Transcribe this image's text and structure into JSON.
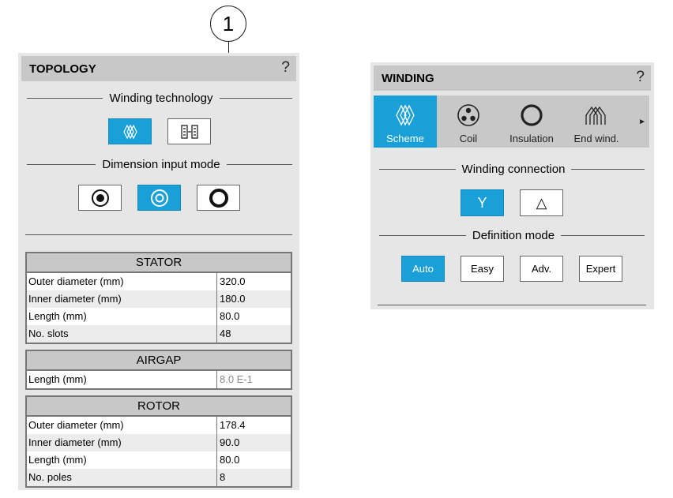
{
  "callout": {
    "number": "1"
  },
  "topology": {
    "title": "TOPOLOGY",
    "help": "?",
    "winding_technology_label": "Winding technology",
    "dimension_input_mode_label": "Dimension input mode",
    "stator": {
      "title": "STATOR",
      "rows": [
        {
          "label": "Outer diameter (mm)",
          "value": "320.0"
        },
        {
          "label": "Inner diameter (mm)",
          "value": "180.0"
        },
        {
          "label": "Length (mm)",
          "value": "80.0"
        },
        {
          "label": "No. slots",
          "value": "48"
        }
      ]
    },
    "airgap": {
      "title": "AIRGAP",
      "rows": [
        {
          "label": "Length (mm)",
          "value": "8.0 E-1"
        }
      ]
    },
    "rotor": {
      "title": "ROTOR",
      "rows": [
        {
          "label": "Outer diameter (mm)",
          "value": "178.4"
        },
        {
          "label": "Inner diameter (mm)",
          "value": "90.0"
        },
        {
          "label": "Length (mm)",
          "value": "80.0"
        },
        {
          "label": "No. poles",
          "value": "8"
        }
      ]
    }
  },
  "winding": {
    "title": "WINDING",
    "help": "?",
    "tabs": [
      {
        "label": "Scheme",
        "icon": "winding-scheme-icon",
        "selected": true
      },
      {
        "label": "Coil",
        "icon": "coil-icon",
        "selected": false
      },
      {
        "label": "Insulation",
        "icon": "insulation-ring-icon",
        "selected": false
      },
      {
        "label": "End wind.",
        "icon": "end-winding-icon",
        "selected": false
      }
    ],
    "more_arrow": "►",
    "winding_connection_label": "Winding connection",
    "star_symbol": "Y",
    "delta_symbol": "△",
    "definition_mode_label": "Definition mode",
    "modes": [
      "Auto",
      "Easy",
      "Adv.",
      "Expert"
    ],
    "selected_mode": "Auto"
  },
  "colors": {
    "accent": "#1aa0d8",
    "panel_bg": "#e6e6e6",
    "header_bg": "#c8c8c8"
  }
}
